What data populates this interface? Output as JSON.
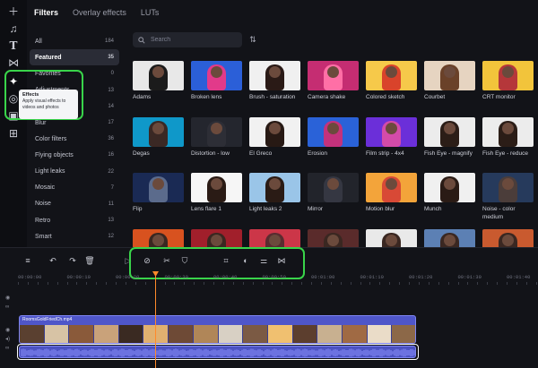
{
  "tabs": [
    {
      "label": "Filters",
      "active": true
    },
    {
      "label": "Overlay effects",
      "active": false
    },
    {
      "label": "LUTs",
      "active": false
    }
  ],
  "rail": [
    {
      "icon": "plus-icon"
    },
    {
      "icon": "music-note-icon"
    },
    {
      "icon": "text-icon"
    },
    {
      "icon": "transitions-icon"
    },
    {
      "icon": "effects-sparkle-icon"
    },
    {
      "icon": "sticker-icon"
    },
    {
      "icon": "layers-icon"
    },
    {
      "icon": "widgets-icon"
    }
  ],
  "tooltip": {
    "title": "Effects",
    "description": "Apply visual effects to videos and photos"
  },
  "categories": [
    {
      "label": "All",
      "count": "184"
    },
    {
      "label": "Featured",
      "count": "35",
      "active": true
    },
    {
      "label": "Favorites",
      "count": "0"
    },
    {
      "label": "Adjustments",
      "count": "13"
    },
    {
      "label": "Artistic",
      "count": "14"
    },
    {
      "label": "Blur",
      "count": "17"
    },
    {
      "label": "Color filters",
      "count": "36"
    },
    {
      "label": "Flying objects",
      "count": "16"
    },
    {
      "label": "Light leaks",
      "count": "22"
    },
    {
      "label": "Mosaic",
      "count": "7"
    },
    {
      "label": "Noise",
      "count": "11"
    },
    {
      "label": "Retro",
      "count": "13"
    },
    {
      "label": "Smart",
      "count": "12"
    }
  ],
  "search": {
    "placeholder": "Search"
  },
  "effects": [
    {
      "label": "Adams",
      "bg": "#e8e8e8",
      "fg": "#1b1b1b"
    },
    {
      "label": "Broken lens",
      "bg": "#2b5fd8",
      "fg": "#e23a8a"
    },
    {
      "label": "Brush - saturation",
      "bg": "#f0f0f0",
      "fg": "#2a1a16"
    },
    {
      "label": "Camera shake",
      "bg": "#c52d72",
      "fg": "#ff6fa6"
    },
    {
      "label": "Colored sketch",
      "bg": "#f6c94a",
      "fg": "#d9432b"
    },
    {
      "label": "Courbet",
      "bg": "#e6d4c1",
      "fg": "#6a4129"
    },
    {
      "label": "CRT monitor",
      "bg": "#f2c43b",
      "fg": "#b5373a"
    },
    {
      "label": "Degas",
      "bg": "#0f98c9",
      "fg": "#3a2824"
    },
    {
      "label": "Distortion - low",
      "bg": "#24262e",
      "fg": "#2d2e36"
    },
    {
      "label": "El Greco",
      "bg": "#f1f1f1",
      "fg": "#271914"
    },
    {
      "label": "Erosion",
      "bg": "#2a62d8",
      "fg": "#c4327c"
    },
    {
      "label": "Film strip - 4x4",
      "bg": "#6b2fd9",
      "fg": "#d44ba9"
    },
    {
      "label": "Fish Eye - magnify",
      "bg": "#ececec",
      "fg": "#2b1d17"
    },
    {
      "label": "Fish Eye - reduce",
      "bg": "#ececec",
      "fg": "#2b1d17"
    },
    {
      "label": "Flip",
      "bg": "#1a2a54",
      "fg": "#5b6b8c"
    },
    {
      "label": "Lens flare 1",
      "bg": "#f6f6f6",
      "fg": "#2a1b15"
    },
    {
      "label": "Light leaks 2",
      "bg": "#9ac5e8",
      "fg": "#2a1b15"
    },
    {
      "label": "Mirror",
      "bg": "#22242b",
      "fg": "#353742"
    },
    {
      "label": "Motion blur",
      "bg": "#f3a43a",
      "fg": "#d84936"
    },
    {
      "label": "Munch",
      "bg": "#f0f0f0",
      "fg": "#2a1b15"
    },
    {
      "label": "Noise - color medium",
      "bg": "#263a5c",
      "fg": "#4b3d3a"
    },
    {
      "label": "",
      "bg": "#d8521f",
      "fg": "#3a2721"
    },
    {
      "label": "",
      "bg": "#a11f2b",
      "fg": "#3a2721"
    },
    {
      "label": "",
      "bg": "#cc3648",
      "fg": "#5a2c30"
    },
    {
      "label": "",
      "bg": "#5a2b2b",
      "fg": "#3a2721"
    },
    {
      "label": "",
      "bg": "#e9e9e9",
      "fg": "#3a2721"
    },
    {
      "label": "",
      "bg": "#5c80b4",
      "fg": "#3a2721"
    },
    {
      "label": "",
      "bg": "#c95a2f",
      "fg": "#3a2721"
    }
  ],
  "toolbar": [
    {
      "icon": "adjust-tracks-icon"
    },
    {
      "icon": "undo-icon"
    },
    {
      "icon": "redo-icon"
    },
    {
      "icon": "delete-icon"
    },
    {
      "icon": "play-icon"
    },
    {
      "icon": "hide-icon"
    },
    {
      "icon": "cut-icon"
    },
    {
      "icon": "mask-icon"
    },
    {
      "icon": "crop-icon"
    },
    {
      "icon": "speed-icon"
    },
    {
      "icon": "settings-sliders-icon"
    },
    {
      "icon": "transition-icon"
    }
  ],
  "ruler": [
    "00:00:00",
    "00:00:10",
    "00:00:20",
    "00:00:30",
    "00:00:40",
    "00:00:50",
    "00:01:00",
    "00:01:10",
    "00:01:20",
    "00:01:30",
    "00:01:40"
  ],
  "clip": {
    "name": "RoomsGoldFriedCh.mp4"
  },
  "accent": "#39d44a",
  "clip_color": "#4f56c9",
  "playhead_color": "#ff8a2a"
}
